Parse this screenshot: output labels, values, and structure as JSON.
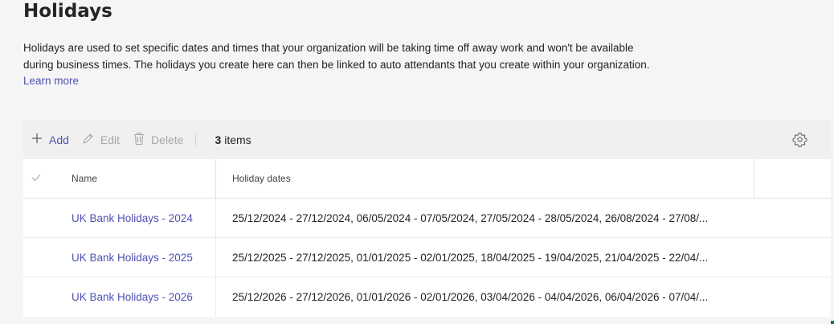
{
  "page": {
    "title": "Holidays",
    "description": "Holidays are used to set specific dates and times that your organization will be taking time off away work and won't be available during business times. The holidays you create here can then be linked to auto attendants that you create within your organization.",
    "learn_more": "Learn more"
  },
  "toolbar": {
    "add_label": "Add",
    "edit_label": "Edit",
    "delete_label": "Delete",
    "count_number": "3",
    "count_suffix": "items",
    "add_icon": "plus-icon",
    "edit_icon": "pencil-icon",
    "delete_icon": "trash-icon",
    "settings_icon": "gear-icon"
  },
  "table": {
    "columns": [
      "Name",
      "Holiday dates"
    ],
    "rows": [
      {
        "name": "UK Bank Holidays - 2024",
        "dates": "25/12/2024 - 27/12/2024, 06/05/2024 - 07/05/2024, 27/05/2024 - 28/05/2024, 26/08/2024 - 27/08/..."
      },
      {
        "name": "UK Bank Holidays - 2025",
        "dates": "25/12/2025 - 27/12/2025, 01/01/2025 - 02/01/2025, 18/04/2025 - 19/04/2025, 21/04/2025 - 22/04/..."
      },
      {
        "name": "UK Bank Holidays - 2026",
        "dates": "25/12/2026 - 27/12/2026, 01/01/2026 - 02/01/2026, 03/04/2026 - 04/04/2026, 06/04/2026 - 07/04/..."
      }
    ]
  },
  "colors": {
    "accent": "#4f52b2",
    "disabled": "#a6a6a6",
    "background": "#f5f5f5"
  }
}
